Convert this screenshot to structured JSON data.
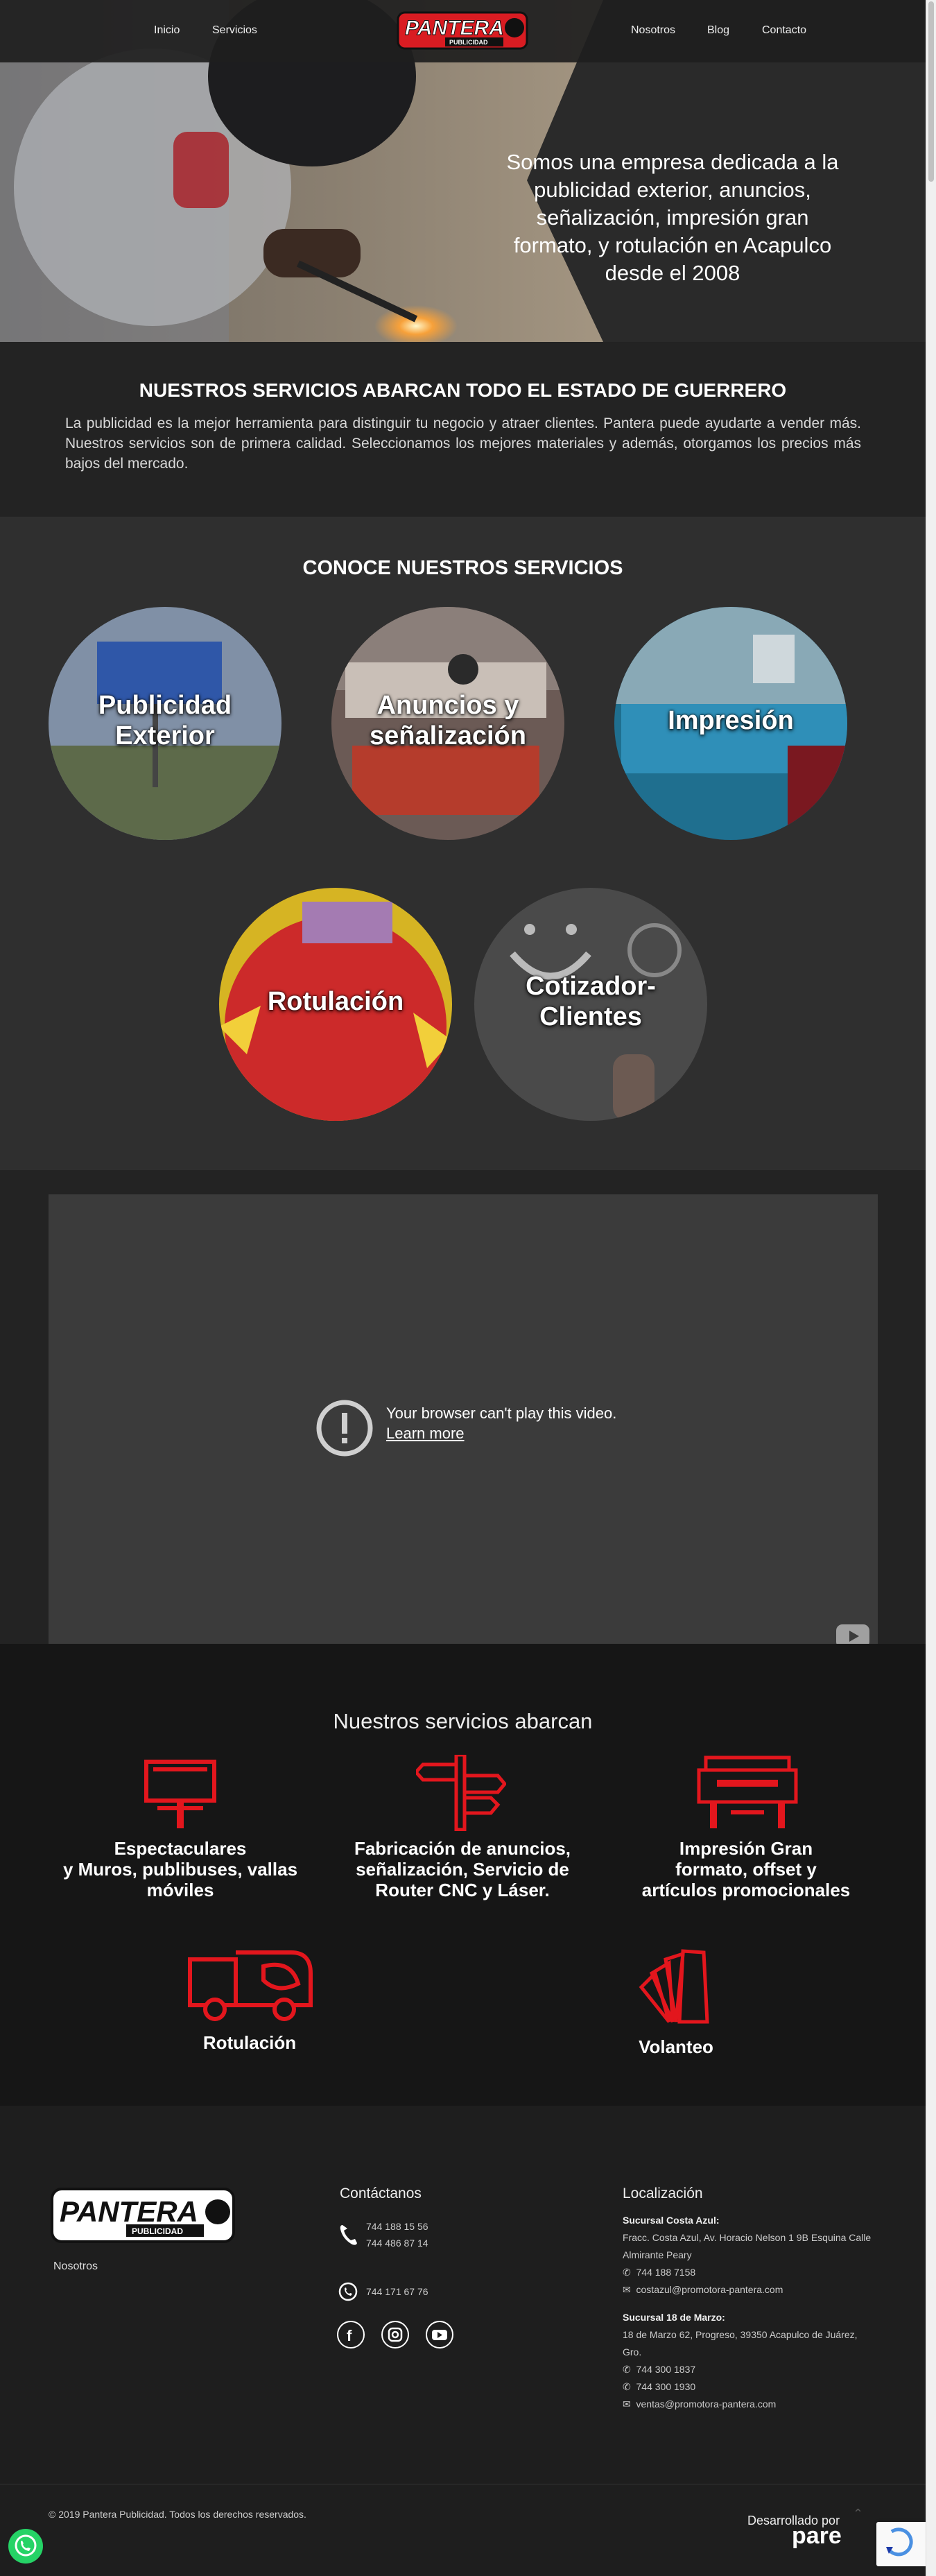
{
  "nav": {
    "items": [
      "Inicio",
      "Servicios",
      "Nosotros",
      "Blog",
      "Contacto"
    ],
    "logo_text": "PANTERA",
    "logo_sub": "PUBLICIDAD"
  },
  "hero": {
    "line1": "Somos una empresa dedicada a la",
    "line2": "publicidad exterior, anuncios,",
    "line3": "señalización, impresión gran",
    "line4": "formato, y rotulación en Acapulco",
    "line5": "desde el 2008"
  },
  "coverage": {
    "title": "NUESTROS SERVICIOS ABARCAN TODO EL ESTADO DE GUERRERO",
    "text": "La publicidad es la mejor herramienta para distinguir tu negocio y atraer clientes. Pantera puede ayudarte a vender más. Nuestros servicios son de primera calidad. Seleccionamos los mejores materiales y además, otorgamos los precios más bajos del mercado."
  },
  "services": {
    "title": "CONOCE NUESTROS SERVICIOS",
    "items": [
      {
        "l1": "Publicidad",
        "l2": "Exterior"
      },
      {
        "l1": "Anuncios y",
        "l2": "señalización"
      },
      {
        "l1": "Impresión",
        "l2": ""
      },
      {
        "l1": "Rotulación",
        "l2": ""
      },
      {
        "l1": "Cotizador-",
        "l2": "Clientes"
      }
    ]
  },
  "video": {
    "message": "Your browser can't play this video.",
    "learn_more": "Learn more"
  },
  "coverage_services": {
    "title": "Nuestros servicios abarcan",
    "items": [
      {
        "l1": "Espectaculares",
        "l2": "y Muros, publibuses, vallas",
        "l3": "móviles"
      },
      {
        "l1": "Fabricación de anuncios,",
        "l2": "señalización, Servicio de",
        "l3": "Router CNC y Láser."
      },
      {
        "l1": "Impresión Gran",
        "l2": "formato, offset y",
        "l3": "artículos promocionales"
      },
      {
        "l1": "Rotulación",
        "l2": "",
        "l3": ""
      },
      {
        "l1": "Volanteo",
        "l2": "",
        "l3": ""
      }
    ],
    "accent": "#e3161d"
  },
  "footer": {
    "nosotros": "Nosotros",
    "contact_title": "Contáctanos",
    "phone1": "744 188 15 56",
    "phone2": "744 486 87 14",
    "whatsapp": "744 171 67 76",
    "location_title": "Localización",
    "branch1_name": "Sucursal Costa Azul:",
    "branch1_addr1": "Fracc. Costa Azul, Av. Horacio Nelson 1 9B Esquina Calle",
    "branch1_addr2": "Almirante Peary",
    "branch1_phone": "744 188 7158",
    "branch1_email": "costazul@promotora-pantera.com",
    "branch2_name": "Sucursal 18 de Marzo:",
    "branch2_addr1": "18 de Marzo 62, Progreso, 39350 Acapulco de Juárez,",
    "branch2_addr2": "Gro.",
    "branch2_phone1": "744 300 1837",
    "branch2_phone2": "744 300 1930",
    "branch2_email": "ventas@promotora-pantera.com",
    "copyright": "© 2019 Pantera Publicidad. Todos los derechos reservados.",
    "developed_by": "Desarrollado por",
    "developer": "pare"
  }
}
